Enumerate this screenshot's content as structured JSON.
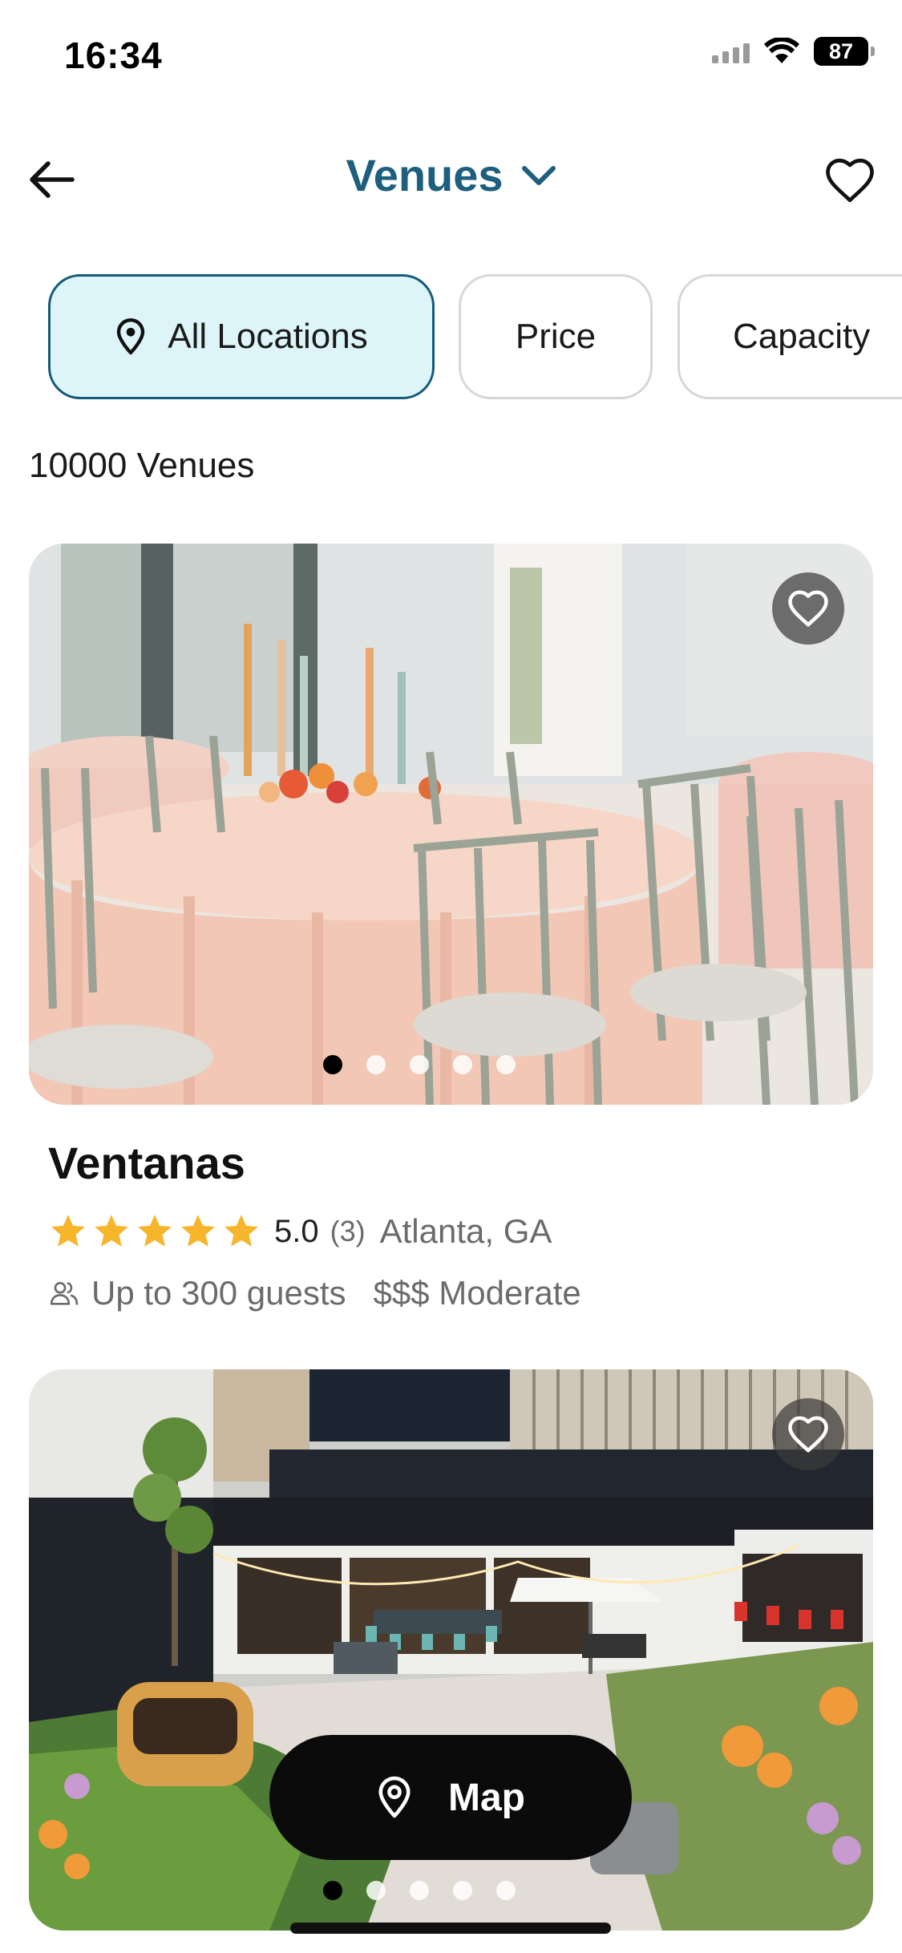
{
  "status_bar": {
    "time": "16:34",
    "battery": "87"
  },
  "nav": {
    "title": "Venues",
    "back_icon": "arrow-left-icon",
    "favorite_icon": "heart-outline-icon",
    "title_color": "#1d5f7d"
  },
  "filters": [
    {
      "label": "All Locations",
      "icon": "map-pin-icon",
      "active": true
    },
    {
      "label": "Price",
      "active": false
    },
    {
      "label": "Capacity",
      "active": false
    }
  ],
  "results": {
    "count_text": "10000 Venues"
  },
  "venues": [
    {
      "name": "Ventanas",
      "rating": "5.0",
      "review_count": "(3)",
      "stars": 5,
      "location": "Atlanta, GA",
      "guests": "Up to 300 guests",
      "price": "$$$ Moderate",
      "photo_count": 5,
      "active_photo": 1
    },
    {
      "photo_count": 5,
      "active_photo": 1
    }
  ],
  "map_button": {
    "label": "Map",
    "icon": "map-pin-icon"
  },
  "colors": {
    "accent": "#1d5f7d",
    "chip_active_bg": "#ddf5f8",
    "star": "#f7b52c"
  }
}
